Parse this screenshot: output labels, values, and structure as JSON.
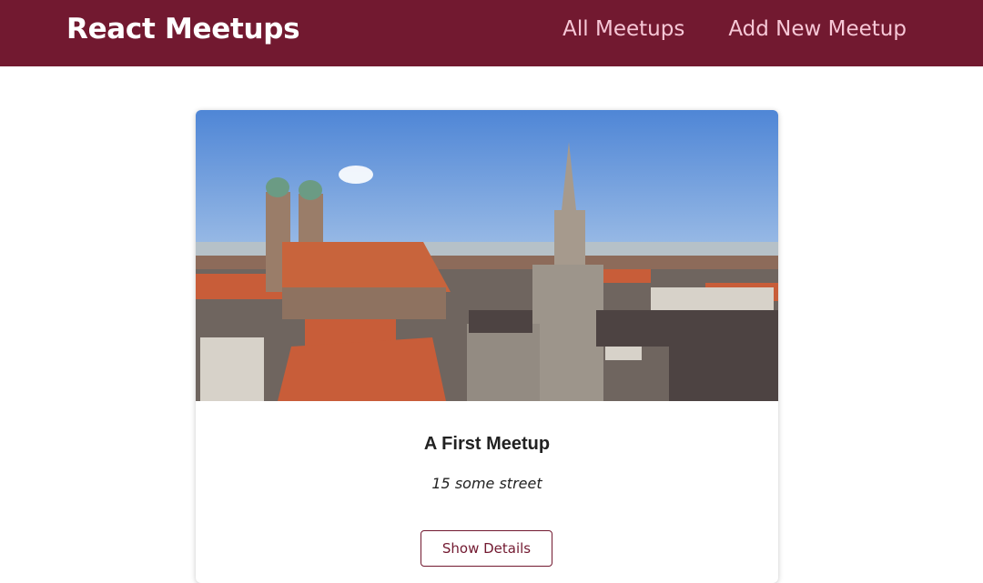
{
  "header": {
    "logo": "React Meetups",
    "nav": [
      "All Meetups",
      "Add New Meetup"
    ]
  },
  "meetup": {
    "image_alt": "Munich city skyline with Frauenkirche and New Town Hall",
    "title": "A First Meetup",
    "address": "15 some street",
    "button_label": "Show Details"
  },
  "colors": {
    "header_bg": "#721930",
    "nav_text": "#f6c7d6",
    "button_border": "#721930"
  }
}
